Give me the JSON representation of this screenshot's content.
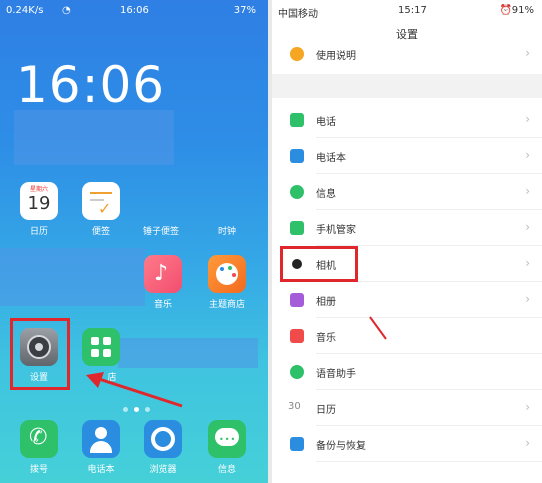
{
  "left_screen": {
    "status": {
      "speed": "0.24K/s",
      "time": "16:06",
      "battery": "37%"
    },
    "clock": "16:06",
    "calendar_weekday": "星期六",
    "calendar_day": "19",
    "apps_row1": [
      {
        "label": "日历"
      },
      {
        "label": "便签"
      },
      {
        "label": "锤子便签"
      },
      {
        "label": "时钟"
      }
    ],
    "apps_row2": [
      {
        "label": "音乐"
      },
      {
        "label": "主题商店"
      }
    ],
    "apps_row3": [
      {
        "label": "设置"
      },
      {
        "label": "店"
      }
    ],
    "dock": [
      {
        "label": "拨号"
      },
      {
        "label": "电话本"
      },
      {
        "label": "浏览器"
      },
      {
        "label": "信息"
      }
    ]
  },
  "right_screen": {
    "status": {
      "carrier": "中国移动",
      "time": "15:17",
      "battery": "91%"
    },
    "title": "设置",
    "items": [
      {
        "label": "使用说明",
        "color": "#f5a623"
      },
      {
        "label": "电话",
        "color": "#2fc06a"
      },
      {
        "label": "电话本",
        "color": "#2b8de0"
      },
      {
        "label": "信息",
        "color": "#2fc06a"
      },
      {
        "label": "手机管家",
        "color": "#2fc06a"
      },
      {
        "label": "相机",
        "color": "#222222"
      },
      {
        "label": "相册",
        "color": "#a55cd9"
      },
      {
        "label": "音乐",
        "color": "#f04a4a"
      },
      {
        "label": "语音助手",
        "color": "#2fc06a"
      },
      {
        "label": "日历",
        "color": "#888888"
      },
      {
        "label": "备份与恢复",
        "color": "#2b8de0"
      }
    ],
    "calendar_num": "30"
  }
}
